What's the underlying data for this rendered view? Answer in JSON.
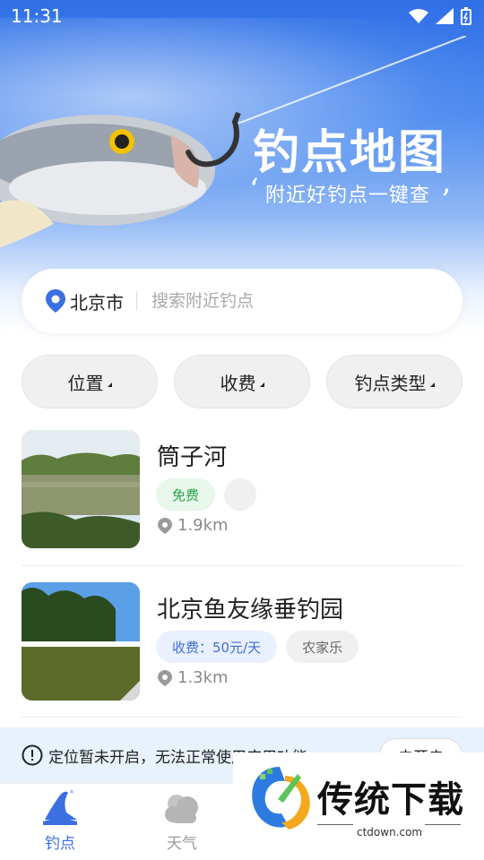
{
  "status_bar": {
    "time": "11:31"
  },
  "hero": {
    "title": "钓点地图",
    "subtitle": "附近好钓点一键查",
    "quote_open": "‘",
    "quote_close": "’"
  },
  "search": {
    "city": "北京市",
    "placeholder": "搜索附近钓点"
  },
  "filters": [
    {
      "label": "位置"
    },
    {
      "label": "收费"
    },
    {
      "label": "钓点类型"
    }
  ],
  "spots": [
    {
      "name": "筒子河",
      "tags": [
        "免费"
      ],
      "distance": "1.9km"
    },
    {
      "name": "北京鱼友缘垂钓园",
      "tags": [
        "收费：50元/天",
        "农家乐"
      ],
      "distance": "1.3km"
    }
  ],
  "notice": {
    "message": "定位暂未开启，无法正常使用应用功能",
    "button": "去开启"
  },
  "tabs": [
    {
      "label": "钓点",
      "icon": "fishing-spot-icon",
      "active": true
    },
    {
      "label": "天气",
      "icon": "weather-cloud-icon",
      "active": false
    }
  ],
  "watermark": {
    "brand": "传统下载",
    "url": "ctdown.com"
  },
  "colors": {
    "accent": "#3b6fe2",
    "free": "#2aa34a",
    "fee": "#3b6fd8"
  }
}
